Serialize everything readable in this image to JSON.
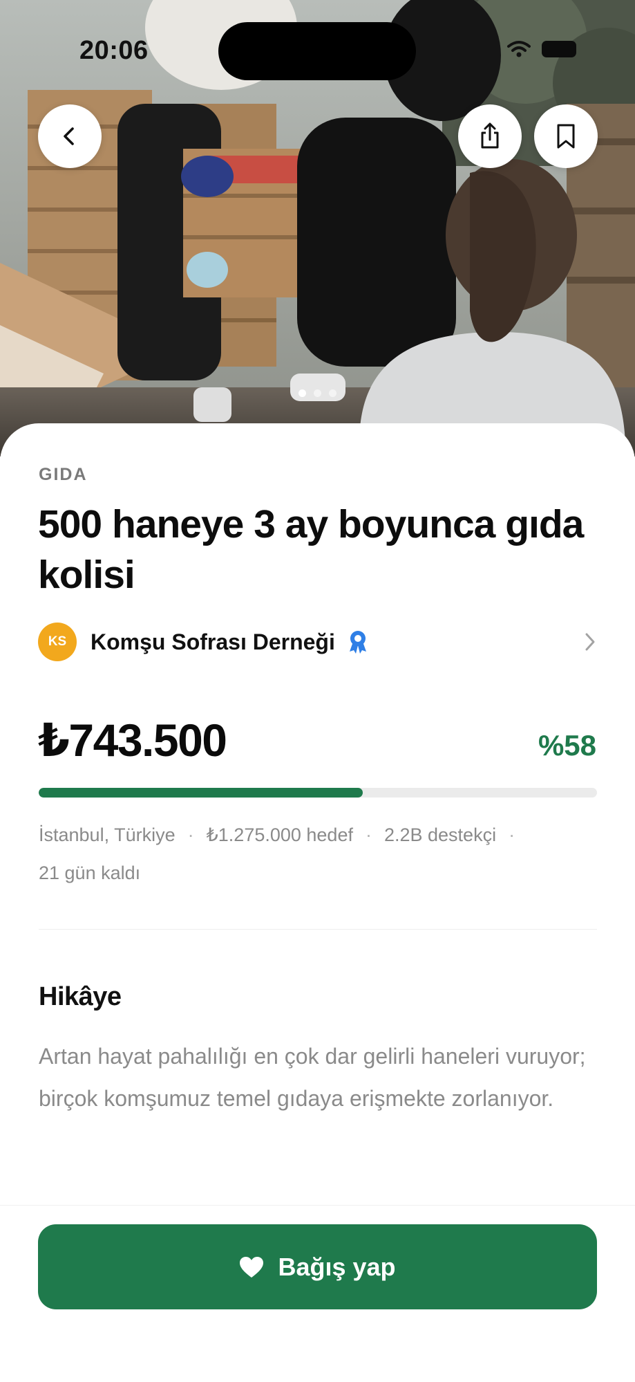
{
  "status_bar": {
    "time": "20:06"
  },
  "campaign": {
    "category": "GIDA",
    "title": "500 haneye 3 ay boyunca gıda kolisi",
    "organization": {
      "initials": "KS",
      "name": "Komşu Sofrası Derneği",
      "verified": true
    },
    "raised": "₺743.500",
    "percent_label": "%58",
    "progress_fraction": 0.58,
    "meta": {
      "location": "İstanbul, Türkiye",
      "goal": "₺1.275.000 hedef",
      "supporters": "2.2B destekçi",
      "days_left": "21 gün kaldı"
    }
  },
  "story": {
    "heading": "Hikâye",
    "text": "Artan hayat pahalılığı en çok dar gelirli haneleri vuruyor; birçok komşumuz temel gıdaya erişmekte zorlanıyor."
  },
  "actions": {
    "donate_label": "Bağış yap"
  },
  "gallery": {
    "page_count": 3,
    "active_index": 0
  },
  "icons": {
    "back": "chevron-left-icon",
    "share": "share-icon",
    "bookmark": "bookmark-icon",
    "verified": "award-badge-icon",
    "org_chevron": "chevron-right-icon",
    "donate": "heart-icon"
  },
  "colors": {
    "accent": "#1f7a4c",
    "avatar": "#f2a81d",
    "verified": "#2f7fe6"
  }
}
